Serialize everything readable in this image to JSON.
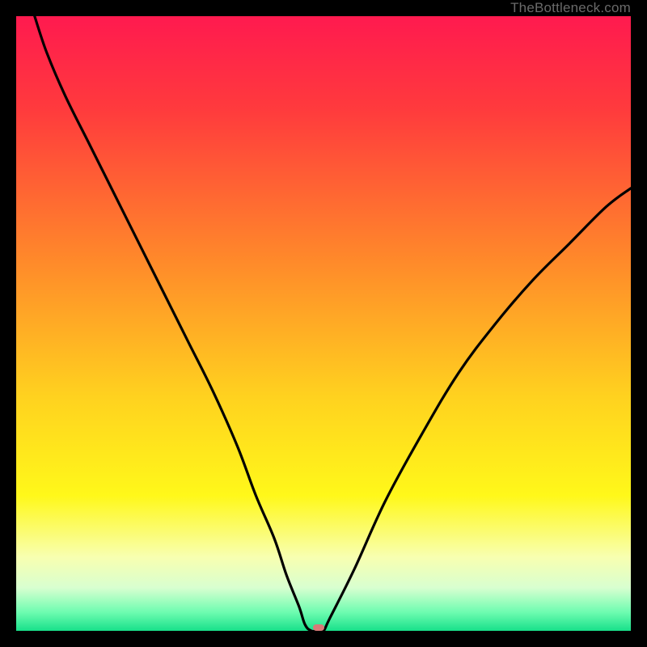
{
  "attribution": "TheBottleneck.com",
  "colors": {
    "gradient_stops": [
      {
        "pct": 0,
        "color": "#ff1a4f"
      },
      {
        "pct": 15,
        "color": "#ff3a3d"
      },
      {
        "pct": 40,
        "color": "#ff8a2a"
      },
      {
        "pct": 62,
        "color": "#ffd21f"
      },
      {
        "pct": 78,
        "color": "#fff81a"
      },
      {
        "pct": 88,
        "color": "#f8ffb0"
      },
      {
        "pct": 93,
        "color": "#d8ffd0"
      },
      {
        "pct": 97,
        "color": "#6dfcb0"
      },
      {
        "pct": 100,
        "color": "#18e08a"
      }
    ],
    "curve_stroke": "#000000",
    "frame": "#000000",
    "marker_fill": "#d87a78"
  },
  "chart_data": {
    "type": "line",
    "title": "",
    "xlabel": "",
    "ylabel": "",
    "xlim": [
      0,
      100
    ],
    "ylim": [
      0,
      100
    ],
    "grid": false,
    "series": [
      {
        "name": "bottleneck-curve",
        "x": [
          3,
          5,
          8,
          12,
          16,
          20,
          24,
          28,
          32,
          36,
          39,
          42,
          44,
          46,
          47,
          48,
          49,
          50,
          51,
          55,
          60,
          66,
          72,
          78,
          84,
          90,
          96,
          100
        ],
        "y": [
          100,
          94,
          87,
          79,
          71,
          63,
          55,
          47,
          39,
          30,
          22,
          15,
          9,
          4,
          1,
          0,
          0,
          0,
          2,
          10,
          21,
          32,
          42,
          50,
          57,
          63,
          69,
          72
        ]
      }
    ],
    "marker": {
      "x": 49.2,
      "y": 0.5
    },
    "legend": false
  }
}
